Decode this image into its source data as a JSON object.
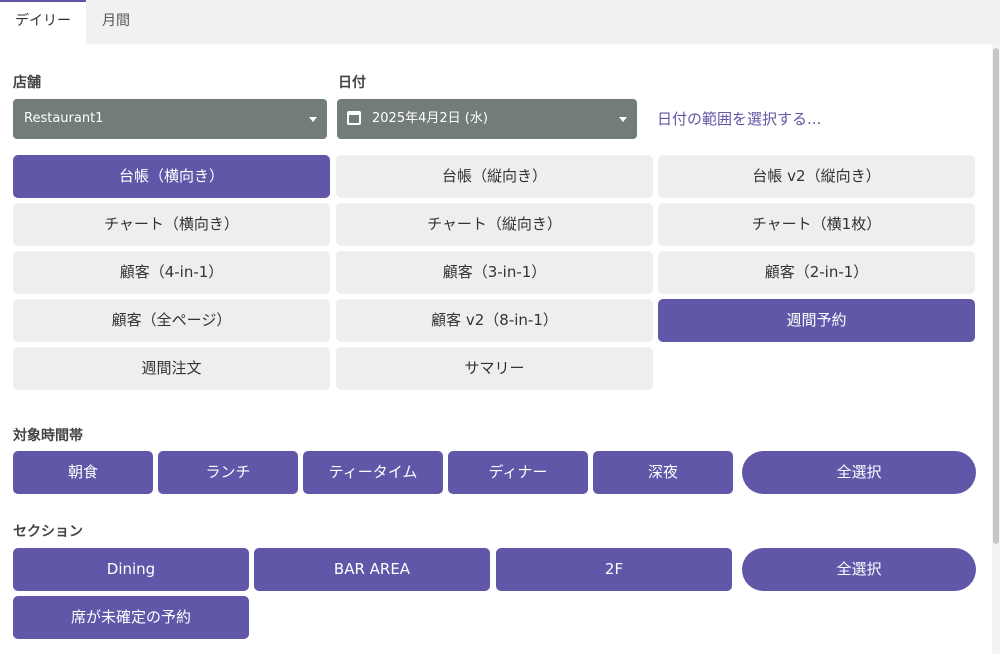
{
  "tabs": {
    "daily": "デイリー",
    "monthly": "月間"
  },
  "store": {
    "label": "店舗",
    "value": "Restaurant1"
  },
  "date": {
    "label": "日付",
    "value": "2025年4月2日 (水)",
    "range_link": "日付の範囲を選択する..."
  },
  "report_types": [
    {
      "label": "台帳（横向き）",
      "selected": true
    },
    {
      "label": "台帳（縦向き）",
      "selected": false
    },
    {
      "label": "台帳 v2（縦向き）",
      "selected": false
    },
    {
      "label": "チャート（横向き）",
      "selected": false
    },
    {
      "label": "チャート（縦向き）",
      "selected": false
    },
    {
      "label": "チャート（横1枚）",
      "selected": false
    },
    {
      "label": "顧客（4-in-1）",
      "selected": false
    },
    {
      "label": "顧客（3-in-1）",
      "selected": false
    },
    {
      "label": "顧客（2-in-1）",
      "selected": false
    },
    {
      "label": "顧客（全ページ）",
      "selected": false
    },
    {
      "label": "顧客 v2（8-in-1）",
      "selected": false
    },
    {
      "label": "週間予約",
      "selected": true
    },
    {
      "label": "週間注文",
      "selected": false
    },
    {
      "label": "サマリー",
      "selected": false
    }
  ],
  "time_slots": {
    "label": "対象時間帯",
    "items": [
      "朝食",
      "ランチ",
      "ティータイム",
      "ディナー",
      "深夜"
    ],
    "select_all": "全選択"
  },
  "sections": {
    "label": "セクション",
    "items": [
      "Dining",
      "BAR AREA",
      "2F"
    ],
    "select_all": "全選択",
    "unassigned": "席が未確定の予約"
  },
  "colors": {
    "accent": "#6157a8",
    "button_gray": "#eeeeee",
    "select_bg": "#727c7a"
  }
}
